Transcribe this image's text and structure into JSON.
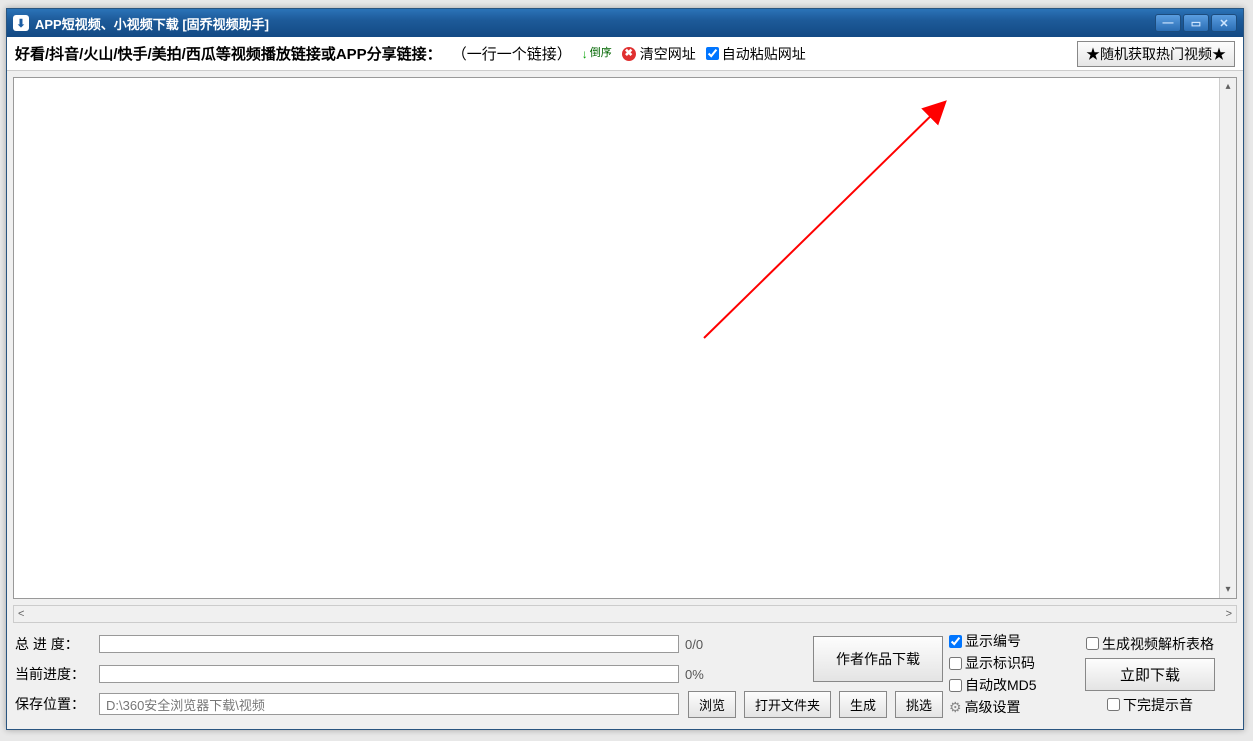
{
  "titlebar": {
    "title": "APP短视频、小视频下载 [固乔视频助手]"
  },
  "toolbar": {
    "instruction": "好看/抖音/火山/快手/美拍/西瓜等视频播放链接或APP分享链接：",
    "hint": "（一行一个链接）",
    "sort_label": "倒序",
    "clear_label": "清空网址",
    "auto_paste_label": "自动粘贴网址",
    "random_button": "★随机获取热门视频★"
  },
  "bottom": {
    "total_progress_label": "总 进 度：",
    "current_progress_label": "当前进度：",
    "save_path_label": "保存位置：",
    "total_progress_text": "0/0",
    "current_progress_text": "0%",
    "save_path_value": "D:\\360安全浏览器下载\\视频",
    "browse_button": "浏览",
    "open_folder_button": "打开文件夹",
    "generate_button": "生成",
    "select_button": "挑选",
    "author_download_button": "作者作品下载",
    "download_now_button": "立即下载"
  },
  "options": {
    "show_number": "显示编号",
    "show_id_code": "显示标识码",
    "auto_change_md5": "自动改MD5",
    "advanced_settings": "高级设置"
  },
  "right_options": {
    "gen_parse_table": "生成视频解析表格",
    "done_sound": "下完提示音"
  }
}
